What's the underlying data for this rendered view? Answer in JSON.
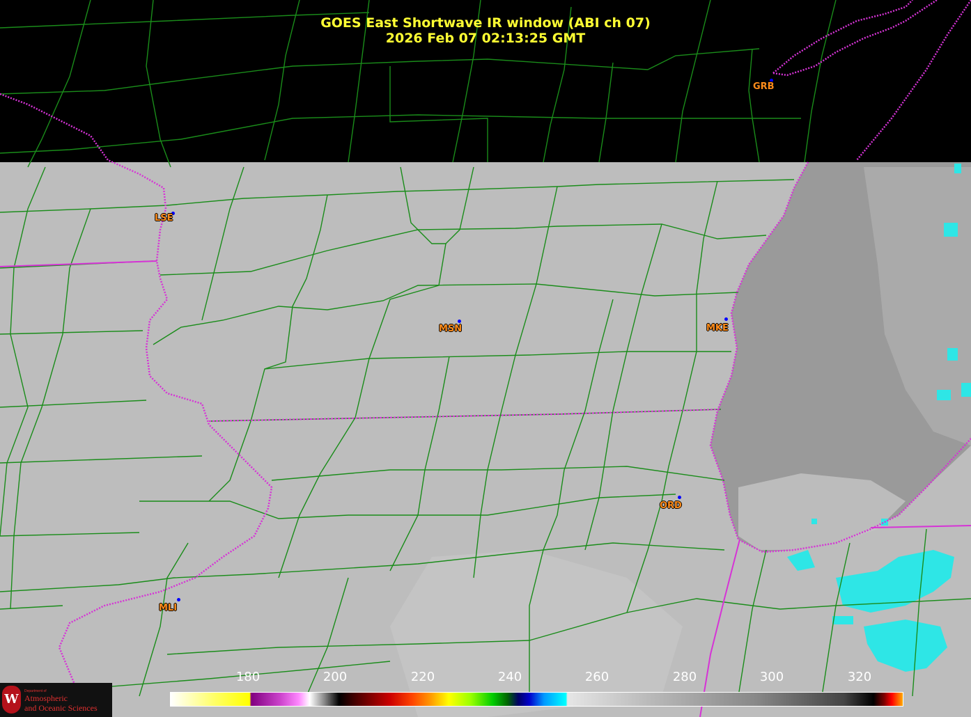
{
  "header": {
    "title_line1": "GOES East Shortwave IR window (ABI ch 07)",
    "title_line2": "2026 Feb 07  02:13:25 GMT"
  },
  "stations": [
    {
      "code": "GRB"
    },
    {
      "code": "LSE"
    },
    {
      "code": "MSN"
    },
    {
      "code": "MKE"
    },
    {
      "code": "ORD"
    },
    {
      "code": "MLI"
    }
  ],
  "colorbar": {
    "ticks": [
      "180",
      "200",
      "220",
      "240",
      "260",
      "280",
      "300",
      "320"
    ]
  },
  "logo": {
    "seal_letter": "W",
    "line1": "Department of",
    "line2": "Atmospheric",
    "line3": "and Oceanic Sciences"
  },
  "colors": {
    "title": "#ffff33",
    "station_label": "#ff8c1a",
    "station_dot": "#0000ff",
    "county_lines": "#1a8c1a",
    "state_borders": "#d633d6",
    "land_ir": "#bdbdbd",
    "lake_ir": "#9a9a9a",
    "cold_cloud": "#2ee6e6",
    "no_data": "#000000"
  }
}
